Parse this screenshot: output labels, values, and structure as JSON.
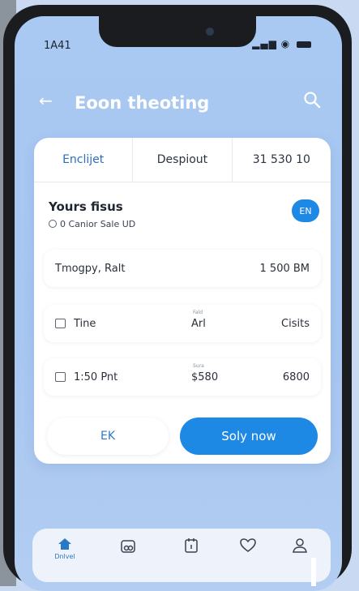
{
  "status": {
    "time": "1A41",
    "signal": "▂▄▆",
    "wifi": "◉"
  },
  "header": {
    "title": "Eoon theoting"
  },
  "tabs": [
    {
      "label": "Enclijet"
    },
    {
      "label": "Despiout"
    },
    {
      "label": "31 530 10"
    }
  ],
  "summary": {
    "title": "Yours fisus",
    "subtitle": "0 Canior Sale UD",
    "chip": "EN"
  },
  "rows": [
    {
      "left": "Tmogpy, Ralt",
      "right": "1 500 BM"
    },
    {
      "left": "Tine",
      "mini": "Fald",
      "middle": "Arl",
      "right": "Cisits"
    },
    {
      "left": "1:50 Pnt",
      "mini": "Sura",
      "middle": "$580",
      "right": "6800"
    }
  ],
  "actions": {
    "secondary": "EK",
    "primary": "Soly now"
  },
  "tabbar": {
    "home_label": "Dnlvel"
  },
  "colors": {
    "accent": "#1e88e5",
    "screen_bg": "#a9c9f3"
  }
}
